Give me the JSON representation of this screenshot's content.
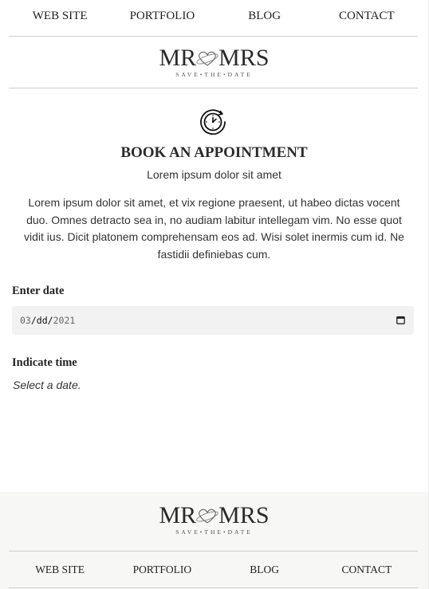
{
  "header": {
    "nav": [
      {
        "label": "WEB SITE"
      },
      {
        "label": "PORTFOLIO"
      },
      {
        "label": "BLOG"
      },
      {
        "label": "CONTACT"
      }
    ],
    "logo": {
      "left": "MR",
      "right": "MRS",
      "tagline": "SAVE•THE•DATE"
    }
  },
  "main": {
    "icon": "clock-refresh-icon",
    "title": "BOOK AN APPOINTMENT",
    "subtitle": "Lorem ipsum dolor sit amet",
    "paragraph": "Lorem ipsum dolor sit amet, et vix regione praesent, ut habeo dictas vocent duo. Omnes detracto sea in, no audiam labitur intellegam vim. No esse quot vidit ius. Dicit platonem comprehensam eos ad. Wisi solet inermis cum id. Ne fastidii definiebas cum.",
    "date_field": {
      "label": "Enter date",
      "month": "03",
      "day": "dd",
      "year": "2021",
      "sep": "/",
      "icon": "calendar-icon"
    },
    "time_field": {
      "label": "Indicate time",
      "hint": "Select a date."
    }
  },
  "footer": {
    "logo": {
      "left": "MR",
      "right": "MRS",
      "tagline": "SAVE•THE•DATE"
    },
    "nav": [
      {
        "label": "WEB SITE"
      },
      {
        "label": "PORTFOLIO"
      },
      {
        "label": "BLOG"
      },
      {
        "label": "CONTACT"
      }
    ]
  },
  "colors": {
    "text": "#2b2b2b",
    "divider": "#cfcfcf",
    "input_bg": "#f1f2f1",
    "footer_bg": "#f7f7f5"
  }
}
